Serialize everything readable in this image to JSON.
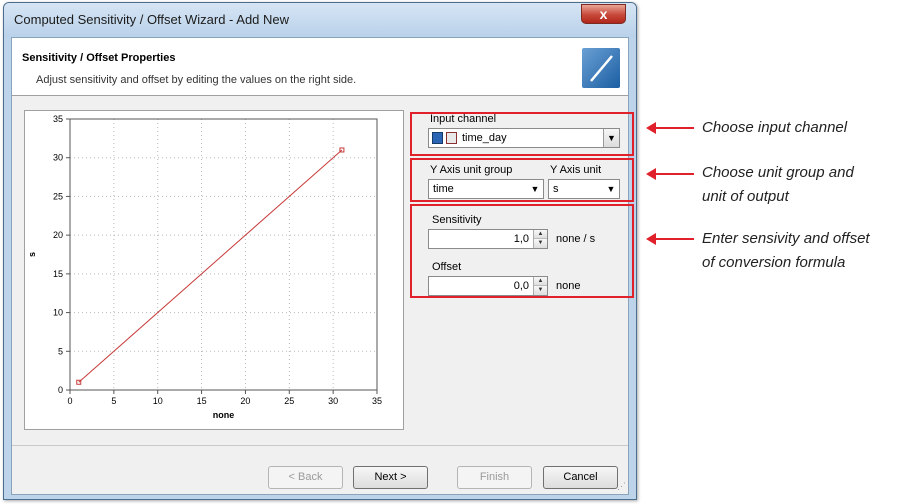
{
  "window": {
    "title": "Computed Sensitivity / Offset Wizard - Add New",
    "close_glyph": "x"
  },
  "header": {
    "title": "Sensitivity / Offset Properties",
    "subtitle": "Adjust sensitivity and offset by editing the values on the right side."
  },
  "input_channel": {
    "label": "Input channel",
    "value": "time_day",
    "icons": [
      "channel-icon",
      "data-icon"
    ]
  },
  "y_axis": {
    "unit_group_label": "Y Axis unit group",
    "unit_group_value": "time",
    "unit_label": "Y Axis unit",
    "unit_value": "s"
  },
  "sensitivity": {
    "label": "Sensitivity",
    "value": "1,0",
    "unit": "none / s"
  },
  "offset": {
    "label": "Offset",
    "value": "0,0",
    "unit": "none"
  },
  "buttons": {
    "back": "< Back",
    "next": "Next >",
    "finish": "Finish",
    "cancel": "Cancel"
  },
  "annotations": {
    "channel": "Choose input channel",
    "unit_line1": "Choose unit group and",
    "unit_line2": "unit of output",
    "sens_line1": "Enter sensivity and offset",
    "sens_line2": "of conversion formula"
  },
  "colors": {
    "highlight": "#e0202a",
    "plot_line": "#c83a3a"
  },
  "chart_data": {
    "type": "line",
    "xlabel": "none",
    "ylabel": "s",
    "xlim": [
      0,
      35
    ],
    "ylim": [
      0,
      35
    ],
    "xticks": [
      0,
      5,
      10,
      15,
      20,
      25,
      30,
      35
    ],
    "yticks": [
      0,
      5,
      10,
      15,
      20,
      25,
      30,
      35
    ],
    "grid": true,
    "series": [
      {
        "x": [
          1,
          31
        ],
        "y": [
          1,
          31
        ]
      }
    ]
  }
}
